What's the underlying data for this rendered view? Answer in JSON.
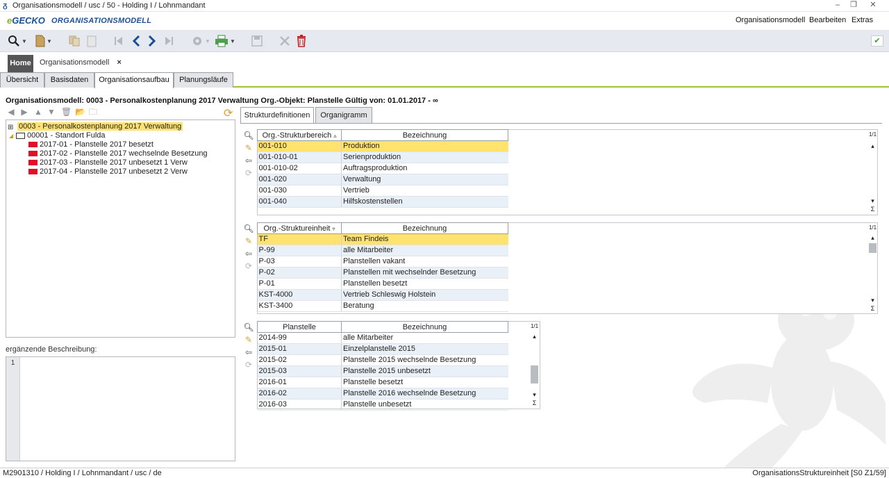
{
  "window": {
    "title": "Organisationsmodell / usc / 50 - Holding I / Lohnmandant"
  },
  "brand": {
    "logo_e": "e",
    "logo_gecko": "GECKO",
    "app_name": "ORGANISATIONSMODELL"
  },
  "menu": [
    "Organisationsmodell",
    "Bearbeiten",
    "Extras"
  ],
  "toolbar_icons": [
    "search-icon",
    "new-document-icon",
    "copy-icon",
    "paste-icon",
    "first-icon",
    "prev-icon",
    "next-icon",
    "last-icon",
    "settings-icon",
    "print-icon",
    "save-icon",
    "cancel-icon",
    "delete-icon"
  ],
  "doc_tabs": {
    "home": "Home",
    "current": "Organisationsmodell",
    "close": "×"
  },
  "sub_tabs": [
    "Übersicht",
    "Basisdaten",
    "Organisationsaufbau",
    "Planungsläufe"
  ],
  "object_line": "Organisationsmodell: 0003 - Personalkostenplanung 2017 Verwaltung Org.-Objekt: Planstelle Gültig von: 01.01.2017 - ∞",
  "tree": {
    "root": "0003 - Personalkostenplanung 2017 Verwaltung",
    "site": "00001 - Standort Fulda",
    "leaves": [
      "2017-01 - Planstelle 2017 besetzt",
      "2017-02 - Planstelle 2017 wechselnde Besetzung",
      "2017-03 - Planstelle 2017 unbesetzt 1 Verw",
      "2017-04 - Planstelle 2017 unbesetzt 2 Verw"
    ]
  },
  "description": {
    "label": "ergänzende Beschreibung:",
    "line_number": "1"
  },
  "right_tabs": [
    "Strukturdefinitionen",
    "Organigramm"
  ],
  "grid1": {
    "headers": [
      "Org.-Strukturbereich",
      "Bezeichnung"
    ],
    "sort_glyph": "▵",
    "page": "1/1",
    "sum": "Σ",
    "rows": [
      [
        "001-010",
        "Produktion"
      ],
      [
        "001-010-01",
        "Serienproduktion"
      ],
      [
        "001-010-02",
        "Auftragsproduktion"
      ],
      [
        "001-020",
        "Verwaltung"
      ],
      [
        "001-030",
        "Vertrieb"
      ],
      [
        "001-040",
        "Hilfskostenstellen"
      ]
    ]
  },
  "grid2": {
    "headers": [
      "Org.-Struktureinheit",
      "Bezeichnung"
    ],
    "sort_glyph": "▿",
    "page": "1/1",
    "sum": "Σ",
    "rows": [
      [
        "TF",
        "Team Findeis"
      ],
      [
        "P-99",
        "alle Mitarbeiter"
      ],
      [
        "P-03",
        "Planstellen vakant"
      ],
      [
        "P-02",
        "Planstellen mit wechselnder Besetzung"
      ],
      [
        "P-01",
        "Planstellen besetzt"
      ],
      [
        "KST-4000",
        "Vertrieb Schleswig Holstein"
      ],
      [
        "KST-3400",
        "Beratung"
      ]
    ]
  },
  "grid3": {
    "headers": [
      "Planstelle",
      "Bezeichnung"
    ],
    "page": "1/1",
    "sum": "Σ",
    "rows": [
      [
        "2014-99",
        "alle Mitarbeiter"
      ],
      [
        "2015-01",
        "Einzelplanstelle 2015"
      ],
      [
        "2015-02",
        "Planstelle 2015 wechselnde Besetzung"
      ],
      [
        "2015-03",
        "Planstelle 2015 unbesetzt"
      ],
      [
        "2016-01",
        "Planstelle besetzt"
      ],
      [
        "2016-02",
        "Planstelle 2016 wechselnde Besetzung"
      ],
      [
        "2016-03",
        "Planstelle unbesetzt"
      ]
    ]
  },
  "status": {
    "left": "M2901310 / Holding I / Lohnmandant / usc / de",
    "right": "OrganisationsStruktureinheit [S0 Z1/59]"
  },
  "colors": {
    "accent": "#9ec23a",
    "highlight": "#ffe36e",
    "brand_blue": "#1a4f96"
  }
}
